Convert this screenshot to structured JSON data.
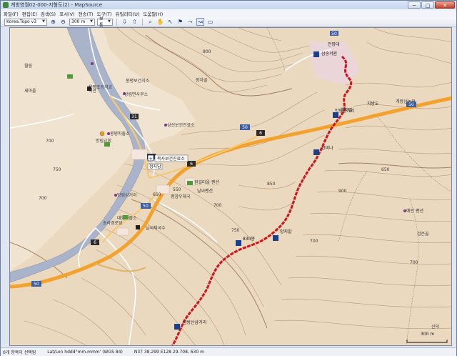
{
  "window": {
    "title": "계방영월02-000-지형도(2) - MapSource",
    "controls": {
      "minimize": "─",
      "maximize": "□",
      "close": "✕"
    }
  },
  "menu": [
    "파일(F)",
    "편집(E)",
    "검색(S)",
    "표시(V)",
    "전송(T)",
    "도구(T)",
    "유틸리티(U)",
    "도움말(H)"
  ],
  "toolbar": {
    "map_product": "Korea.Topo v3",
    "zoom_scale": "300 m",
    "detail": "보통",
    "tool_icons": [
      "zoom-in-icon",
      "zoom-out-icon",
      "pan-icon",
      "select-icon",
      "waypoint-icon",
      "route-icon",
      "track-icon",
      "measure-icon"
    ]
  },
  "map": {
    "scale_label": "300 m",
    "road_shields": [
      "50",
      "31",
      "6",
      "50",
      "6",
      "31",
      "50",
      "6",
      "50",
      "50"
    ],
    "facility_labels": [
      "목사보건진료소",
      "정지담",
      "봉평보건지소",
      "원길마을 펜션",
      "방림면사무소",
      "삼선보건진료소",
      "예린 펜션",
      "봉평파출소",
      "대화파출소",
      "방림삼거리",
      "용평초등학교",
      "계방산농원",
      "평창우체국",
      "날씨펜션",
      "방림교회"
    ],
    "contour_labels": [
      "700",
      "750",
      "700",
      "650",
      "550",
      "700",
      "750",
      "850",
      "700",
      "650",
      "700",
      "800",
      "900"
    ],
    "poi_labels": [
      "날씨체국수",
      "송라경로당",
      "여관",
      "월림",
      "새마을",
      "방림삼거리",
      "검은골",
      "신덕",
      "장자골"
    ],
    "track_waypoints": [
      "삼송서원",
      "양지말",
      "산비나",
      "양지말",
      "830봉",
      "삼방산삼거리",
      "지방도",
      "전망대"
    ],
    "colors": {
      "track": "#d0131c",
      "highway": "#f09a2a",
      "terrain": "#ead8bf",
      "river": "#a9b3c9"
    }
  },
  "status": {
    "selection": "0개 항목이 선택됨",
    "coord_format": "Lat/Lon hddd°mm.mmm' (WGS 84)",
    "position": "N37 38.299 E128 29.708, 630 m"
  }
}
